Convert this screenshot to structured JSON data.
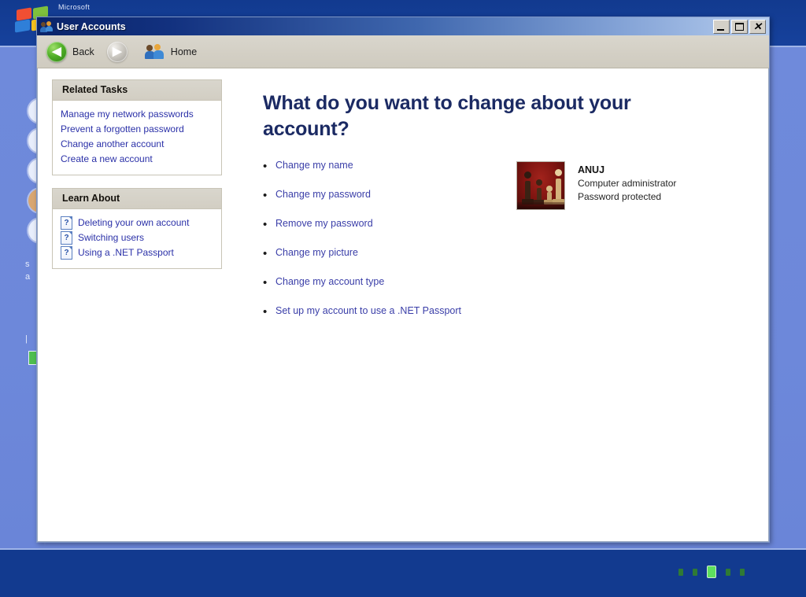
{
  "desktop": {
    "brand_text": "Microsoft",
    "logo_icon": "windows-flag-logo",
    "loading_dots_count": 5
  },
  "window": {
    "title": "User Accounts",
    "title_icon": "users-icon",
    "controls": {
      "minimize": "minimize-button",
      "maximize": "maximize-button",
      "close": "close-button",
      "close_glyph": "✕"
    }
  },
  "toolbar": {
    "back_label": "Back",
    "back_icon": "back-arrow-icon",
    "back_glyph": "◀",
    "forward_icon": "forward-arrow-icon",
    "forward_glyph": "▶",
    "home_label": "Home",
    "home_icon": "home-users-icon"
  },
  "sidebar": {
    "panels": [
      {
        "title": "Related Tasks",
        "items": [
          {
            "label": "Manage my network passwords"
          },
          {
            "label": "Prevent a forgotten password"
          },
          {
            "label": "Change another account"
          },
          {
            "label": "Create a new account"
          }
        ]
      },
      {
        "title": "Learn About",
        "items": [
          {
            "label": "Deleting your own account",
            "icon": "help-question-icon",
            "glyph": "?"
          },
          {
            "label": "Switching users",
            "icon": "help-question-icon",
            "glyph": "?"
          },
          {
            "label": "Using a .NET Passport",
            "icon": "help-question-icon",
            "glyph": "?"
          }
        ]
      }
    ]
  },
  "main": {
    "heading": "What do you want to change about your account?",
    "bullet_glyph": "•",
    "tasks": [
      {
        "label": "Change my name"
      },
      {
        "label": "Change my password"
      },
      {
        "label": "Remove my password"
      },
      {
        "label": "Change my picture"
      },
      {
        "label": "Change my account type"
      },
      {
        "label": "Set up my account to use a .NET Passport"
      }
    ],
    "account": {
      "picture_icon": "chess-account-picture",
      "name": "ANUJ",
      "type": "Computer administrator",
      "password_status": "Password protected"
    }
  },
  "colors": {
    "title_bar_start": "#0a246a",
    "title_bar_end": "#b6cdee",
    "toolbar_bg": "#d4d0c8",
    "heading_text": "#1b2a63",
    "link_text": "#3a3ea8",
    "sidebar_link": "#2b31a8",
    "desktop_blue": "#6a85d8",
    "desktop_dark_blue": "#123a8f",
    "avatar_red": "#7d1410",
    "loading_green": "#5ee05e"
  }
}
